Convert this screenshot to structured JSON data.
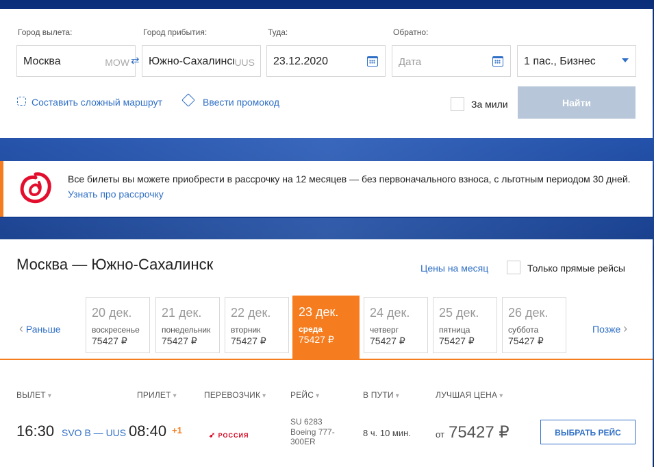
{
  "search": {
    "from_label": "Город вылета:",
    "from_value": "Москва",
    "from_code": "MOW",
    "to_label": "Город прибытия:",
    "to_value": "Южно-Сахалинск",
    "to_code": "UUS",
    "depart_label": "Туда:",
    "depart_value": "23.12.2020",
    "return_label": "Обратно:",
    "return_placeholder": "Дата",
    "passengers_value": "1 пас., Бизнес",
    "complex_route_link": "Составить сложный маршрут",
    "promo_code_link": "Ввести промокод",
    "miles_label": "За мили",
    "find_button": "Найти"
  },
  "promo": {
    "text": "Все билеты вы можете приобрести в рассрочку на 12 месяцев — без первоначального взноса, с льготным периодом 30 дней.",
    "link": "Узнать про рассрочку"
  },
  "results": {
    "route_title": "Москва — Южно-Сахалинск",
    "month_prices_link": "Цены на месяц",
    "direct_only_label": "Только прямые рейсы",
    "earlier": "Раньше",
    "later": "Позже",
    "days": [
      {
        "date": "20 дек.",
        "weekday": "воскресенье",
        "price": "75427 ₽"
      },
      {
        "date": "21 дек.",
        "weekday": "понедельник",
        "price": "75427 ₽"
      },
      {
        "date": "22 дек.",
        "weekday": "вторник",
        "price": "75427 ₽"
      },
      {
        "date": "23 дек.",
        "weekday": "среда",
        "price": "75427 ₽"
      },
      {
        "date": "24 дек.",
        "weekday": "четверг",
        "price": "75427 ₽"
      },
      {
        "date": "25 дек.",
        "weekday": "пятница",
        "price": "75427 ₽"
      },
      {
        "date": "26 дек.",
        "weekday": "суббота",
        "price": "75427 ₽"
      }
    ],
    "columns": {
      "departure": "ВЫЛЕТ",
      "arrival": "ПРИЛЕТ",
      "carrier": "ПЕРЕВОЗЧИК",
      "flight": "РЕЙС",
      "duration": "В ПУТИ",
      "best_price": "ЛУЧШАЯ ЦЕНА"
    },
    "flight": {
      "dep_time": "16:30",
      "route": "SVO B — UUS",
      "arr_time": "08:40",
      "day_offset": "+1",
      "carrier": "РОССИЯ",
      "number": "SU 6283",
      "aircraft": "Boeing 777-300ER",
      "duration": "8 ч. 10 мин.",
      "price_prefix": "от",
      "price": "75427 ₽",
      "select_button": "ВЫБРАТЬ РЕЙС"
    }
  },
  "colors": {
    "accent": "#2f6fc6",
    "orange": "#f57d20",
    "find_disabled": "#b7c6d8"
  }
}
